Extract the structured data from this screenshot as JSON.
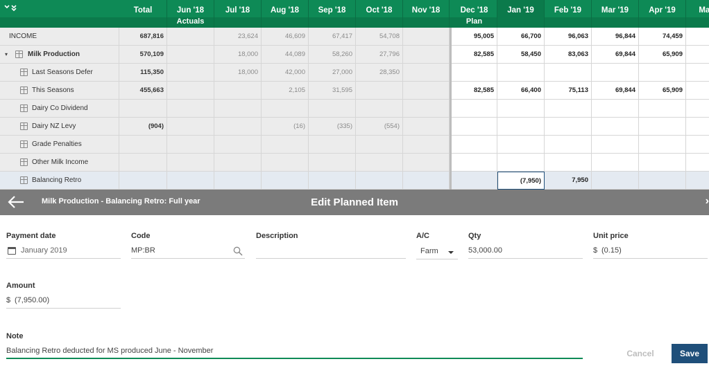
{
  "grid": {
    "columns": [
      {
        "label": "Total",
        "sub": ""
      },
      {
        "label": "Jun '18",
        "sub": "Actuals"
      },
      {
        "label": "Jul '18",
        "sub": ""
      },
      {
        "label": "Aug '18",
        "sub": ""
      },
      {
        "label": "Sep '18",
        "sub": ""
      },
      {
        "label": "Oct '18",
        "sub": ""
      },
      {
        "label": "Nov '18",
        "sub": ""
      },
      {
        "label": "Dec '18",
        "sub": "Plan"
      },
      {
        "label": "Jan '19",
        "sub": ""
      },
      {
        "label": "Feb '19",
        "sub": ""
      },
      {
        "label": "Mar '19",
        "sub": ""
      },
      {
        "label": "Apr '19",
        "sub": ""
      },
      {
        "label": "May",
        "sub": ""
      }
    ],
    "rows": [
      {
        "label": "INCOME",
        "total": "687,816",
        "values": [
          "",
          "23,624",
          "46,609",
          "67,417",
          "54,708",
          "",
          "95,005",
          "66,700",
          "96,063",
          "96,844",
          "74,459",
          ""
        ]
      },
      {
        "label": "Milk Production",
        "total": "570,109",
        "values": [
          "",
          "18,000",
          "44,089",
          "58,260",
          "27,796",
          "",
          "82,585",
          "58,450",
          "83,063",
          "69,844",
          "65,909",
          ""
        ]
      },
      {
        "label": "Last Seasons Defer",
        "total": "115,350",
        "values": [
          "",
          "18,000",
          "42,000",
          "27,000",
          "28,350",
          "",
          "",
          "",
          "",
          "",
          "",
          ""
        ]
      },
      {
        "label": "This Seasons",
        "total": "455,663",
        "values": [
          "",
          "",
          "2,105",
          "31,595",
          "",
          "",
          "82,585",
          "66,400",
          "75,113",
          "69,844",
          "65,909",
          ""
        ]
      },
      {
        "label": "Dairy Co Dividend",
        "total": "",
        "values": [
          "",
          "",
          "",
          "",
          "",
          "",
          "",
          "",
          "",
          "",
          "",
          ""
        ]
      },
      {
        "label": "Dairy NZ Levy",
        "total": "(904)",
        "values": [
          "",
          "",
          "(16)",
          "(335)",
          "(554)",
          "",
          "",
          "",
          "",
          "",
          "",
          ""
        ]
      },
      {
        "label": "Grade Penalties",
        "total": "",
        "values": [
          "",
          "",
          "",
          "",
          "",
          "",
          "",
          "",
          "",
          "",
          "",
          ""
        ]
      },
      {
        "label": "Other Milk Income",
        "total": "",
        "values": [
          "",
          "",
          "",
          "",
          "",
          "",
          "",
          "",
          "",
          "",
          "",
          ""
        ]
      },
      {
        "label": "Balancing Retro",
        "total": "",
        "values": [
          "",
          "",
          "",
          "",
          "",
          "",
          "",
          "(7,950)",
          "7,950",
          "",
          "",
          ""
        ]
      }
    ]
  },
  "edit_bar": {
    "subtitle": "Milk Production - Balancing Retro: Full year",
    "title": "Edit Planned Item"
  },
  "form": {
    "payment_date": {
      "label": "Payment date",
      "value": "January 2019"
    },
    "code": {
      "label": "Code",
      "value": "MP:BR"
    },
    "description": {
      "label": "Description",
      "value": ""
    },
    "ac": {
      "label": "A/C",
      "value": "Farm"
    },
    "qty": {
      "label": "Qty",
      "value": "53,000.00"
    },
    "unit_price": {
      "label": "Unit price",
      "currency": "$",
      "value": "(0.15)"
    },
    "amount": {
      "label": "Amount",
      "currency": "$",
      "value": "(7,950.00)"
    },
    "note": {
      "label": "Note",
      "value": "Balancing Retro deducted for MS produced June - November"
    }
  },
  "actions": {
    "cancel": "Cancel",
    "save": "Save"
  },
  "colors": {
    "header": "#0e8a56",
    "edit_bar": "#7b7b7b",
    "save_button": "#1f4f7a",
    "selected_row": "#e4eaf1"
  }
}
